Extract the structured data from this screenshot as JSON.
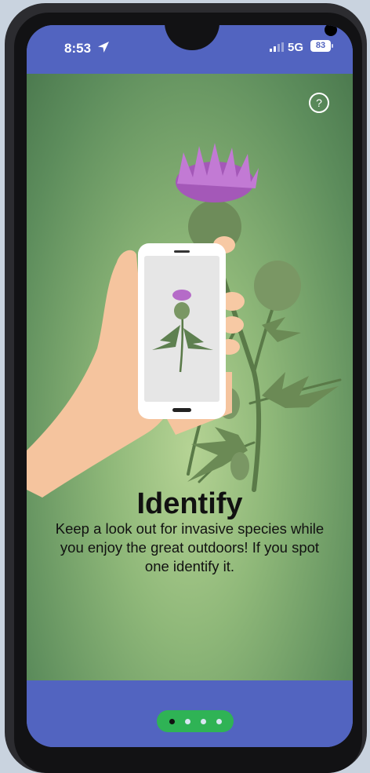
{
  "status_bar": {
    "time": "8:53",
    "network": "5G",
    "battery": "83",
    "icons": [
      "location-arrow-icon",
      "signal-icon"
    ]
  },
  "onboarding": {
    "help_label": "?",
    "title": "Identify",
    "description": "Keep a look out for invasive species while you enjoy the great outdoors! If you spot one identify it.",
    "illustration": "hand-holding-phone-with-thistle",
    "pager": {
      "total_pages": 4,
      "current_page": 1
    }
  },
  "colors": {
    "bar": "#5264c0",
    "background_green": "#8fb879",
    "pager": "#2fb355"
  }
}
